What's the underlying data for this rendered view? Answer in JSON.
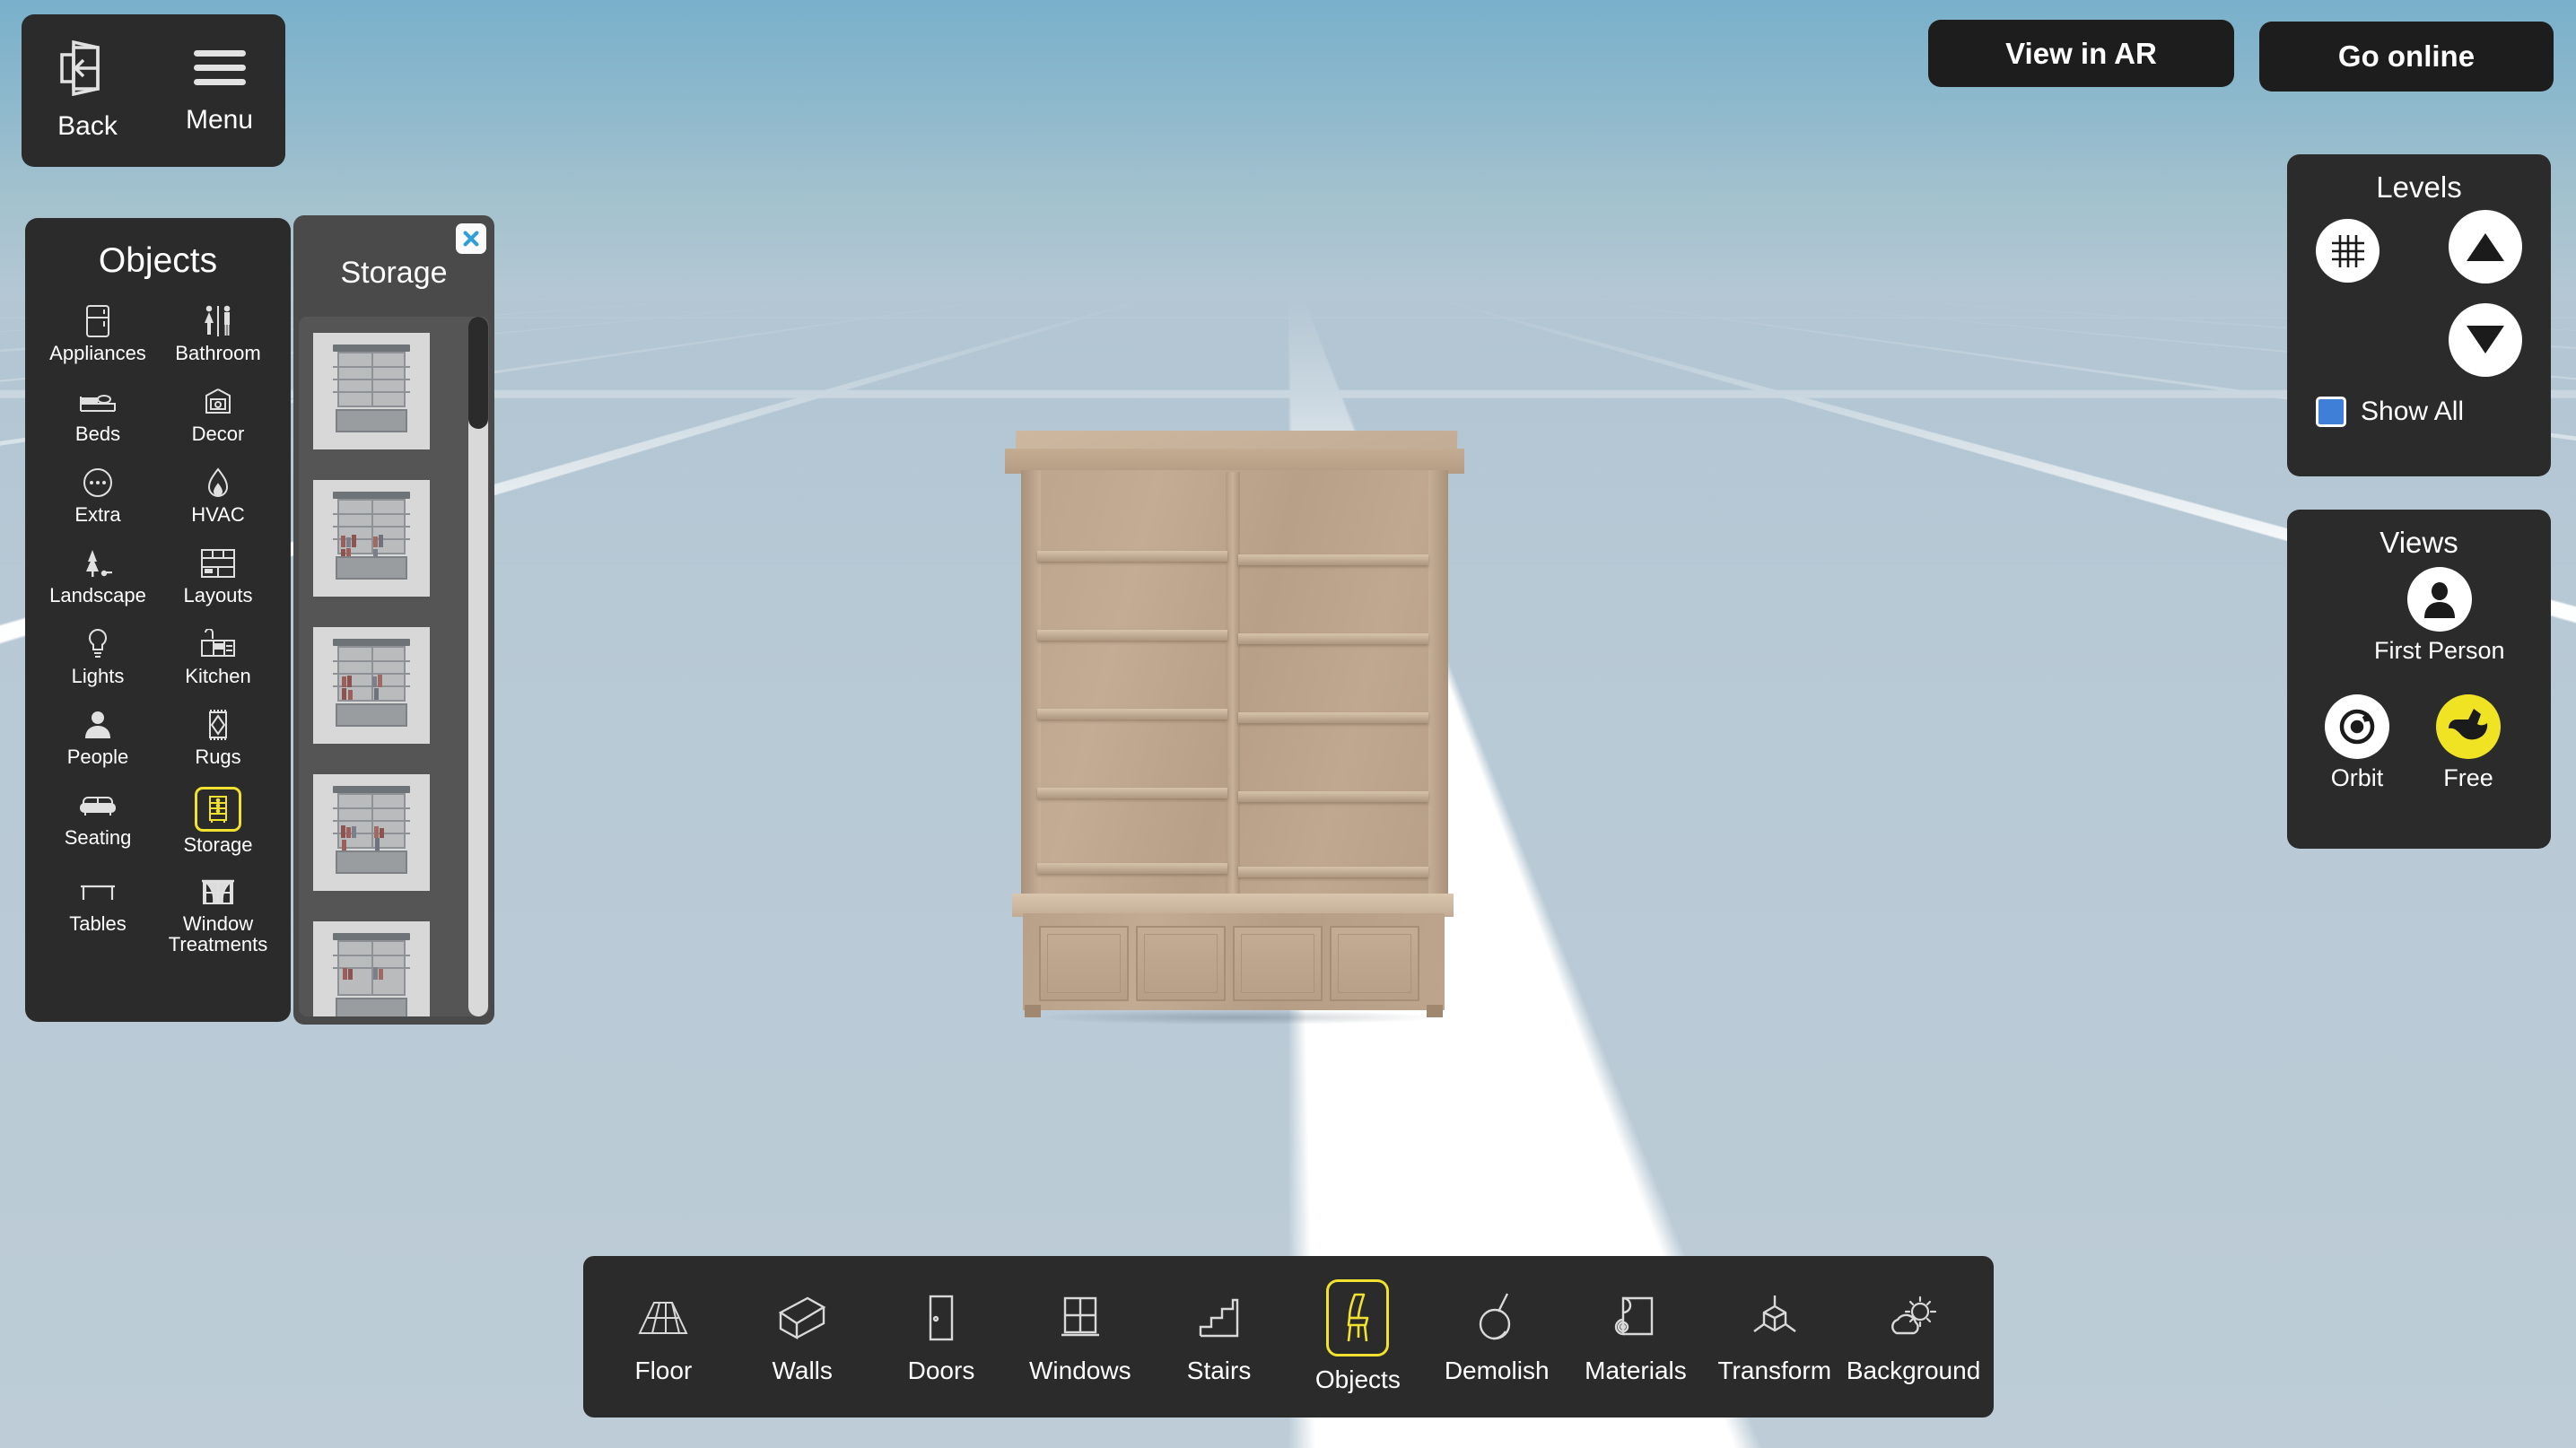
{
  "topleft": {
    "back": {
      "label": "Back",
      "icon": "exit-back-icon"
    },
    "menu": {
      "label": "Menu",
      "icon": "hamburger-menu-icon"
    }
  },
  "topright": {
    "view_in_ar": "View in AR",
    "go_online": "Go online"
  },
  "objects_panel": {
    "title": "Objects",
    "selected": "Storage",
    "items": [
      {
        "label": "Appliances",
        "icon": "refrigerator-icon"
      },
      {
        "label": "Bathroom",
        "icon": "restroom-people-icon"
      },
      {
        "label": "Beds",
        "icon": "bed-icon"
      },
      {
        "label": "Decor",
        "icon": "framed-picture-icon"
      },
      {
        "label": "Extra",
        "icon": "ellipsis-circle-icon"
      },
      {
        "label": "HVAC",
        "icon": "flame-icon"
      },
      {
        "label": "Landscape",
        "icon": "tree-icon"
      },
      {
        "label": "Layouts",
        "icon": "layout-grid-icon"
      },
      {
        "label": "Lights",
        "icon": "lightbulb-icon"
      },
      {
        "label": "Kitchen",
        "icon": "kitchen-counter-icon"
      },
      {
        "label": "People",
        "icon": "person-icon"
      },
      {
        "label": "Rugs",
        "icon": "rug-icon"
      },
      {
        "label": "Seating",
        "icon": "sofa-icon"
      },
      {
        "label": "Storage",
        "icon": "dresser-icon"
      },
      {
        "label": "Tables",
        "icon": "table-icon"
      },
      {
        "label": "Window Treatments",
        "icon": "curtains-icon"
      }
    ]
  },
  "storage_panel": {
    "title": "Storage",
    "close_icon": "close-x-icon",
    "thumbnails": [
      {
        "name": "bookshelf-hutch-empty",
        "books": 0
      },
      {
        "name": "bookshelf-hutch-full-1",
        "books": 14
      },
      {
        "name": "bookshelf-hutch-full-2",
        "books": 12
      },
      {
        "name": "bookshelf-hutch-full-3",
        "books": 15
      },
      {
        "name": "bookshelf-hutch-full-4",
        "books": 13
      }
    ]
  },
  "levels_panel": {
    "title": "Levels",
    "grid_icon": "grid-icon",
    "up_icon": "triangle-up-icon",
    "down_icon": "triangle-down-icon",
    "show_all_label": "Show All",
    "show_all_checked": true,
    "checkbox_color": "#3f7fd8"
  },
  "views_panel": {
    "title": "Views",
    "active": "Free",
    "items": [
      {
        "label": "First Person",
        "icon": "person-avatar-icon",
        "active": false
      },
      {
        "label": "Orbit",
        "icon": "orbit-target-icon",
        "active": false
      },
      {
        "label": "Free",
        "icon": "bird-fly-icon",
        "active": true
      }
    ],
    "active_color": "#f0e324"
  },
  "toolbar": {
    "selected": "Objects",
    "selected_color": "#f2e230",
    "items": [
      {
        "label": "Floor",
        "icon": "floor-planks-icon"
      },
      {
        "label": "Walls",
        "icon": "wall-block-icon"
      },
      {
        "label": "Doors",
        "icon": "door-icon"
      },
      {
        "label": "Windows",
        "icon": "window-icon"
      },
      {
        "label": "Stairs",
        "icon": "stairs-icon"
      },
      {
        "label": "Objects",
        "icon": "chair-icon"
      },
      {
        "label": "Demolish",
        "icon": "wrecking-ball-icon"
      },
      {
        "label": "Materials",
        "icon": "material-roll-icon"
      },
      {
        "label": "Transform",
        "icon": "transform-axes-icon"
      },
      {
        "label": "Background",
        "icon": "sun-cloud-icon"
      }
    ]
  },
  "scene": {
    "object": "bookshelf-hutch",
    "object_color": "#bda48c",
    "sky_top_color": "#79b0cb",
    "ground_color": "#b3c6d3",
    "grid_line_color": "#ffffff"
  }
}
